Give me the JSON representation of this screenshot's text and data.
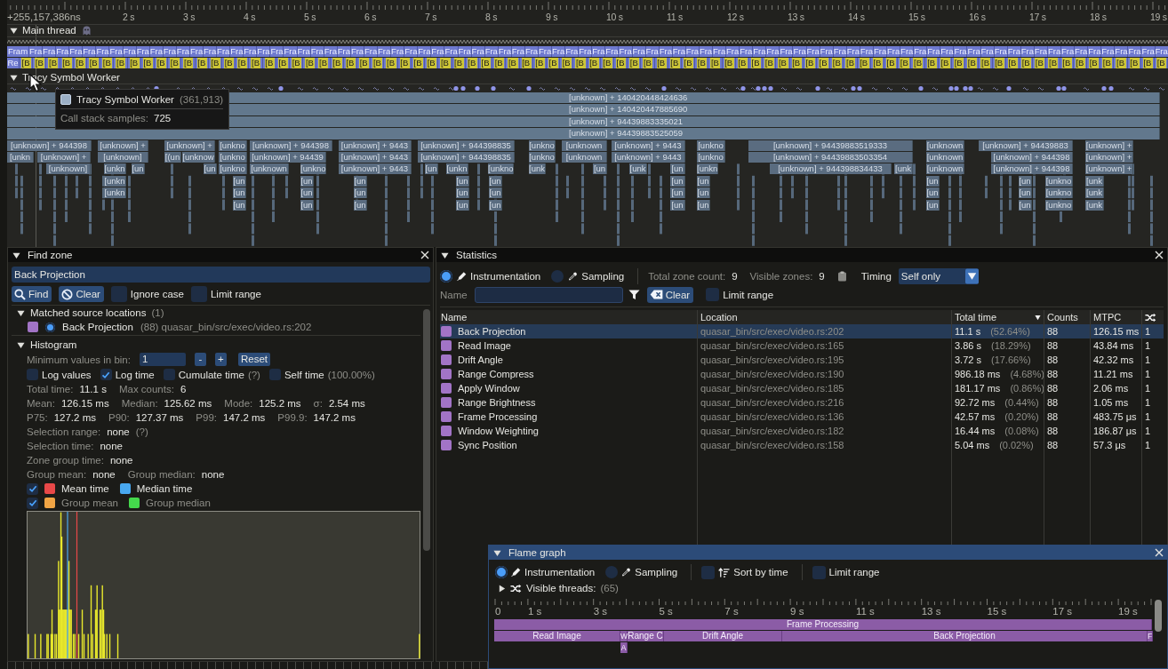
{
  "timeline": {
    "ruler": {
      "origin": "+255,157,386ns",
      "ticks": [
        "2 s",
        "3 s",
        "4 s",
        "5 s",
        "6 s",
        "7 s",
        "8 s",
        "9 s",
        "10 s",
        "11 s",
        "12 s",
        "13 s",
        "14 s",
        "15 s",
        "16 s",
        "17 s",
        "18 s",
        "19 s"
      ]
    },
    "threads": [
      {
        "kind": "zones",
        "name": "Main thread",
        "expanded": true,
        "zone_rows": [
          {
            "kind": "frame",
            "blocks": [
              "Fram",
              "Fra",
              "Fra",
              "Fra",
              "Fra",
              "Fra",
              "Fra",
              "Fra",
              "Fra",
              "Fra",
              "Fra",
              "Fra",
              "Fra",
              "Fra",
              "Fra",
              "Fra",
              "Fra",
              "Fra",
              "Fra",
              "Fra",
              "Fra",
              "Fra",
              "Fra",
              "Fra",
              "Fra",
              "Fra",
              "Fra",
              "Fra",
              "Fra",
              "Fra",
              "Fra",
              "Fra",
              "Fra",
              "Fra",
              "Fra",
              "Fra",
              "Fra",
              "Fra",
              "Fra",
              "Fra",
              "Fra",
              "Fra",
              "Fra",
              "Fra",
              "Fra",
              "Fra",
              "Fra",
              "Fra",
              "Fra",
              "Fra",
              "Fra",
              "Fra",
              "Fra",
              "Fra",
              "Fra",
              "Fra",
              "Fra",
              "Fra",
              "Fra",
              "Fra",
              "Fra",
              "Fra",
              "Fra",
              "Fra",
              "Fra",
              "Fra",
              "Fra",
              "Fra",
              "Fra",
              "Fra",
              "Fra",
              "Fra",
              "Fra",
              "Fra",
              "Fra",
              "Fra",
              "Fra",
              "Fra",
              "Fra",
              "Fra",
              "Fra",
              "Fra",
              "Fra",
              "Fra",
              "Fra",
              "Fra"
            ]
          },
          {
            "kind": "nested",
            "blocks": [
              "Re",
              "[B",
              "[B",
              "[B",
              "[B",
              "[B",
              "[B",
              "[B",
              "[B",
              "[B",
              "[B",
              "[B",
              "[B",
              "[B",
              "[B",
              "[B",
              "[B",
              "[B",
              "[B",
              "[B",
              "[B",
              "[B",
              "[B",
              "[B",
              "[B",
              "[B",
              "[B",
              "[B",
              "[B",
              "[B",
              "[B",
              "[B",
              "[B",
              "[B",
              "[B",
              "[B",
              "[B",
              "[B",
              "[B",
              "[B",
              "[B",
              "[B",
              "[B",
              "[B",
              "[B",
              "[B",
              "[B",
              "[B",
              "[B",
              "[B",
              "[B",
              "[B",
              "[B",
              "[B",
              "[B",
              "[B",
              "[B",
              "[B",
              "[B",
              "[B",
              "[B",
              "[B",
              "[B",
              "[B",
              "[B",
              "[B",
              "[B",
              "[B",
              "[B",
              "[B",
              "[B",
              "[B",
              "[B",
              "[B",
              "[B",
              "[B",
              "[B",
              "[B",
              "[B",
              "[B",
              "[B",
              "[B",
              "[B",
              "[B",
              "[B",
              "[B"
            ]
          }
        ]
      },
      {
        "kind": "samples",
        "name": "Tracy Symbol Worker",
        "expanded": true,
        "stack_rows": [
          [
            "[unknown] + 140420448424636"
          ],
          [
            "[unknown] + 140420447885690"
          ],
          [
            "[unknown] + 94439883335021"
          ],
          [
            "[unknown] + 94439883525059"
          ],
          [
            "[unknown] + 944398",
            "[unknown] +",
            "[unknown] +",
            "[unkno",
            "[unknown] + 944398",
            "[unknown] + 9443",
            "[unknown] + 944398835",
            "[unkno",
            "[unknown",
            "[unknown] + 9443",
            "[unkno",
            "[unknown] + 94439883519333",
            "[unknown",
            "[unknown] + 94439883",
            "[unknown] +"
          ],
          [
            "[unkn",
            "[unknown] +",
            "[unknown]",
            "[(un",
            "[unknow",
            "[unkno",
            "[unknown] + 94439",
            "[unknown] + 9443",
            "[unknown] + 944398835",
            "[unkno",
            "[unknown",
            "[unknown] + 9443",
            "[unkno",
            "[unknown] + 94439883503354",
            "[unknown",
            "[unknown] + 944398",
            "[unknown] +"
          ],
          [
            "[unknown]",
            "[unkn",
            "[un",
            "[un",
            "[unkno",
            "[unknown",
            "[unkno",
            "[unknown] + 9443",
            "[un",
            "[unkn",
            "[unkno",
            "[unk",
            "[un",
            "[unk",
            "[un",
            "[unkn",
            "[unknown] + 944398834433",
            "[unk",
            "[unknown",
            "[unknown] + 944398",
            "[unknown] +"
          ],
          [
            "[unkn",
            "[un",
            "[un",
            "[un",
            "[un",
            "[un",
            "[un",
            "[un",
            "[un",
            "[un",
            "[unkno",
            "[unk"
          ],
          [
            "[unkn",
            "[un",
            "[un",
            "[un",
            "[un",
            "[un",
            "[un",
            "[un",
            "[un",
            "[un",
            "[unkno",
            "[unk"
          ],
          [
            "[un",
            "[un",
            "[un",
            "[un",
            "[un",
            "[un",
            "[un",
            "[un",
            "[un",
            "[unkno",
            "[unk"
          ]
        ]
      }
    ],
    "tooltip": {
      "name": "Tracy Symbol Worker",
      "count": "(361,913)",
      "label": "Call stack samples:",
      "value": "725"
    }
  },
  "find_zone": {
    "title": "Find zone",
    "expanded": true,
    "query": "Back Projection",
    "find_button": "Find",
    "clear_button": "Clear",
    "options": [
      {
        "label": "Ignore case",
        "checked": false
      },
      {
        "label": "Limit range",
        "checked": false
      }
    ],
    "matched": {
      "label": "Matched source locations",
      "count": "(1)",
      "expanded": true,
      "items": [
        {
          "name": "Back Projection",
          "detail": "(88) quasar_bin/src/exec/video.rs:202",
          "selected": true
        }
      ]
    },
    "histogram": {
      "label": "Histogram",
      "expanded": true,
      "min_bin": {
        "label": "Minimum values in bin:",
        "value": "1",
        "minus": "-",
        "plus": "+",
        "reset": "Reset"
      },
      "toggles": [
        {
          "label": "Log values",
          "checked": false
        },
        {
          "label": "Log time",
          "checked": true
        },
        {
          "label": "Cumulate time",
          "checked": false,
          "note": "(?)"
        },
        {
          "label": "Self time",
          "checked": false,
          "note": "(100.00%)"
        }
      ],
      "stats": [
        [
          {
            "label": "Total time:",
            "value": "11.1 s"
          },
          {
            "label": "Max counts:",
            "value": "6"
          }
        ],
        [
          {
            "label": "Mean:",
            "value": "126.15 ms"
          },
          {
            "label": "Median:",
            "value": "125.62 ms"
          },
          {
            "label": "Mode:",
            "value": "125.2 ms"
          },
          {
            "label": "σ:",
            "value": "2.54 ms"
          }
        ],
        [
          {
            "label": "P75:",
            "value": "127.2 ms"
          },
          {
            "label": "P90:",
            "value": "127.37 ms"
          },
          {
            "label": "P99:",
            "value": "147.2 ms"
          },
          {
            "label": "P99.9:",
            "value": "147.2 ms"
          }
        ],
        [
          {
            "label": "Selection range:",
            "value": "none",
            "note": "(?)"
          }
        ],
        [
          {
            "label": "Selection time:",
            "value": "none"
          }
        ],
        [
          {
            "label": "Zone group time:",
            "value": "none"
          }
        ],
        [
          {
            "label": "Group mean:",
            "value": "none"
          },
          {
            "label": "Group median:",
            "value": "none"
          }
        ]
      ],
      "markers": [
        {
          "checked": true,
          "disabled": false,
          "items": [
            {
              "label": "Mean time",
              "color": "#e84848"
            },
            {
              "label": "Median time",
              "color": "#48a8f0"
            }
          ]
        },
        {
          "checked": true,
          "disabled": true,
          "items": [
            {
              "label": "Group mean",
              "color": "#f0a444"
            },
            {
              "label": "Group median",
              "color": "#44d84c"
            }
          ]
        }
      ]
    }
  },
  "statistics": {
    "title": "Statistics",
    "expanded": true,
    "modes": [
      {
        "kind": "instrumentation",
        "label": "Instrumentation",
        "selected": true
      },
      {
        "kind": "sampling",
        "label": "Sampling",
        "selected": false
      }
    ],
    "summary": [
      {
        "label": "Total zone count:",
        "value": "9"
      },
      {
        "label": "Visible zones:",
        "value": "9"
      }
    ],
    "timing": {
      "label": "Timing",
      "value": "Self only"
    },
    "filter": {
      "label": "Name",
      "clear": "Clear",
      "limit_range": {
        "label": "Limit range",
        "checked": false
      }
    },
    "columns": [
      {
        "label": "Name",
        "sorted": false
      },
      {
        "label": "Location",
        "sorted": false
      },
      {
        "label": "Total time",
        "sorted": true
      },
      {
        "label": "Counts",
        "sorted": false
      },
      {
        "label": "MTPC",
        "sorted": false
      }
    ],
    "rows": [
      {
        "name": "Back Projection",
        "location": "quasar_bin/src/exec/video.rs:202",
        "total": "11.1 s",
        "percent": "(52.64%)",
        "counts": "88",
        "mtpc": "126.15 ms",
        "column_6": "1",
        "selected": true
      },
      {
        "name": "Read Image",
        "location": "quasar_bin/src/exec/video.rs:165",
        "total": "3.86 s",
        "percent": "(18.29%)",
        "counts": "88",
        "mtpc": "43.84 ms",
        "column_6": "1",
        "selected": false
      },
      {
        "name": "Drift Angle",
        "location": "quasar_bin/src/exec/video.rs:195",
        "total": "3.72 s",
        "percent": "(17.66%)",
        "counts": "88",
        "mtpc": "42.32 ms",
        "column_6": "1",
        "selected": false
      },
      {
        "name": "Range Compress",
        "location": "quasar_bin/src/exec/video.rs:190",
        "total": "986.18 ms",
        "percent": "(4.68%)",
        "counts": "88",
        "mtpc": "11.21 ms",
        "column_6": "1",
        "selected": false
      },
      {
        "name": "Apply Window",
        "location": "quasar_bin/src/exec/video.rs:185",
        "total": "181.17 ms",
        "percent": "(0.86%)",
        "counts": "88",
        "mtpc": "2.06 ms",
        "column_6": "1",
        "selected": false
      },
      {
        "name": "Range Brightness",
        "location": "quasar_bin/src/exec/video.rs:216",
        "total": "92.72 ms",
        "percent": "(0.44%)",
        "counts": "88",
        "mtpc": "1.05 ms",
        "column_6": "1",
        "selected": false
      },
      {
        "name": "Frame Processing",
        "location": "quasar_bin/src/exec/video.rs:136",
        "total": "42.57 ms",
        "percent": "(0.20%)",
        "counts": "88",
        "mtpc": "483.75 μs",
        "column_6": "1",
        "selected": false
      },
      {
        "name": "Window Weighting",
        "location": "quasar_bin/src/exec/video.rs:182",
        "total": "16.44 ms",
        "percent": "(0.08%)",
        "counts": "88",
        "mtpc": "186.87 μs",
        "column_6": "1",
        "selected": false
      },
      {
        "name": "Sync Position",
        "location": "quasar_bin/src/exec/video.rs:158",
        "total": "5.04 ms",
        "percent": "(0.02%)",
        "counts": "88",
        "mtpc": "57.3 μs",
        "column_6": "1",
        "selected": false
      }
    ]
  },
  "flame_graph": {
    "title": "Flame graph",
    "expanded": true,
    "modes": [
      {
        "kind": "instrumentation",
        "label": "Instrumentation",
        "selected": true
      },
      {
        "kind": "sampling",
        "label": "Sampling",
        "selected": false
      }
    ],
    "options": [
      {
        "kind": "sort",
        "label": "Sort by time",
        "checked": false
      },
      {
        "kind": "range",
        "label": "Limit range",
        "checked": false
      }
    ],
    "threads": {
      "label": "Visible threads:",
      "count": "(65)",
      "expanded": false
    },
    "axis": [
      "0",
      "1 s",
      "3 s",
      "5 s",
      "7 s",
      "9 s",
      "11 s",
      "13 s",
      "15 s",
      "17 s",
      "19 s"
    ],
    "zones": [
      {
        "label": "Frame Processing",
        "children": [
          {
            "label": "Read Image"
          },
          {
            "label": "W",
            "children": [
              {
                "label": "A"
              }
            ]
          },
          {
            "label": "Range C"
          },
          {
            "label": "Drift Angle"
          },
          {
            "label": "Back Projection"
          },
          {
            "label": "F"
          }
        ]
      }
    ]
  }
}
